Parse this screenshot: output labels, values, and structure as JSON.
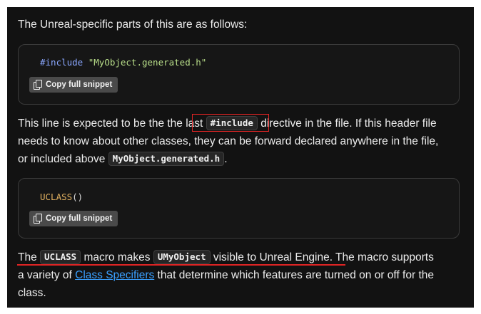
{
  "intro": "The Unreal-specific parts of this are as follows:",
  "snippet1": {
    "keyword": "#include",
    "string": "\"MyObject.generated.h\"",
    "copy_label": "Copy full snippet"
  },
  "para1": {
    "l1_a": "This line is expected to be the the ",
    "l1_b": "last ",
    "l1_code": "#include",
    "l1_c": " directive in the file. If this header file",
    "l2": "needs to know about other classes, they can be forward declared anywhere in the file,",
    "l3_a": "or included above ",
    "l3_code": "MyObject.generated.h",
    "l3_b": "."
  },
  "snippet2": {
    "macro": "UCLASS",
    "punct": "()",
    "copy_label": "Copy full snippet"
  },
  "para2": {
    "l1_a": "The ",
    "l1_code1": "UCLASS",
    "l1_b": " macro makes ",
    "l1_code2": "UMyObject",
    "l1_c": " visible to Unreal Engine. The macro supports",
    "l2_a": "a variety of ",
    "l2_link": "Class Specifiers",
    "l2_b": " that determine which features are turned on or off for the",
    "l3": "class."
  },
  "colors": {
    "background": "#121212",
    "highlight": "#e02424",
    "link": "#3aa0ff"
  }
}
